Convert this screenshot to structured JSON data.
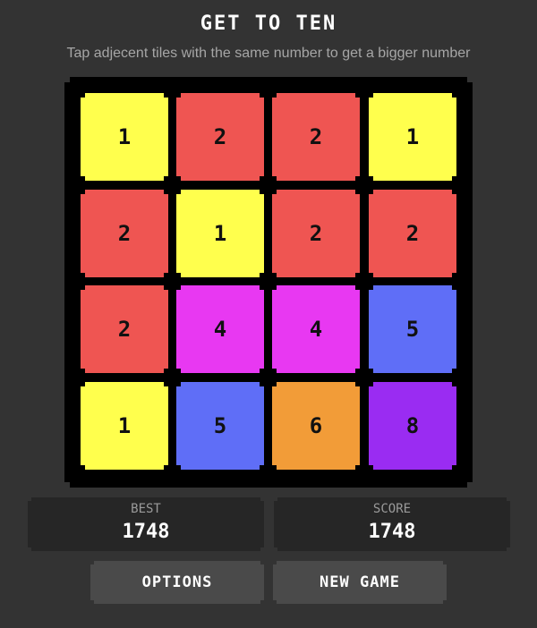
{
  "header": {
    "title": "GET TO TEN",
    "subtitle": "Tap adjecent tiles with the same number to get a bigger number"
  },
  "board": {
    "rows": [
      [
        "1",
        "2",
        "2",
        "1"
      ],
      [
        "2",
        "1",
        "2",
        "2"
      ],
      [
        "2",
        "4",
        "4",
        "5"
      ],
      [
        "1",
        "5",
        "6",
        "8"
      ]
    ]
  },
  "tile_colors": {
    "1": "#ffff4d",
    "2": "#ef5552",
    "4": "#e838f2",
    "5": "#5f6ef7",
    "6": "#f29c38",
    "8": "#9a2cf2"
  },
  "stats": {
    "best_label": "BEST",
    "best_value": "1748",
    "score_label": "SCORE",
    "score_value": "1748"
  },
  "buttons": {
    "options_label": "OPTIONS",
    "new_game_label": "NEW GAME"
  }
}
